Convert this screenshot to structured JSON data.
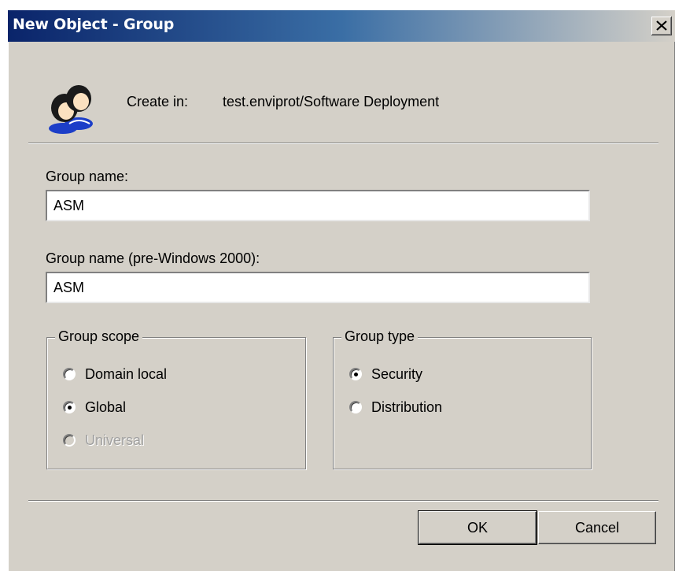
{
  "window": {
    "title": "New Object - Group"
  },
  "header": {
    "icon": "users-group-icon",
    "create_in_label": "Create in:",
    "create_in_path": "test.enviprot/Software Deployment"
  },
  "form": {
    "group_name_label": "Group name:",
    "group_name_value": "ASM",
    "pre2000_label": "Group name (pre-Windows 2000):",
    "pre2000_value": "ASM"
  },
  "group_scope": {
    "legend": "Group scope",
    "options": [
      {
        "label": "Domain local",
        "checked": false,
        "enabled": true
      },
      {
        "label": "Global",
        "checked": true,
        "enabled": true
      },
      {
        "label": "Universal",
        "checked": false,
        "enabled": false
      }
    ]
  },
  "group_type": {
    "legend": "Group type",
    "options": [
      {
        "label": "Security",
        "checked": true,
        "enabled": true
      },
      {
        "label": "Distribution",
        "checked": false,
        "enabled": true
      }
    ]
  },
  "buttons": {
    "ok": "OK",
    "cancel": "Cancel"
  },
  "colors": {
    "titlebar_start": "#0a246a",
    "titlebar_end": "#d4d0c8",
    "face": "#d4d0c8"
  }
}
